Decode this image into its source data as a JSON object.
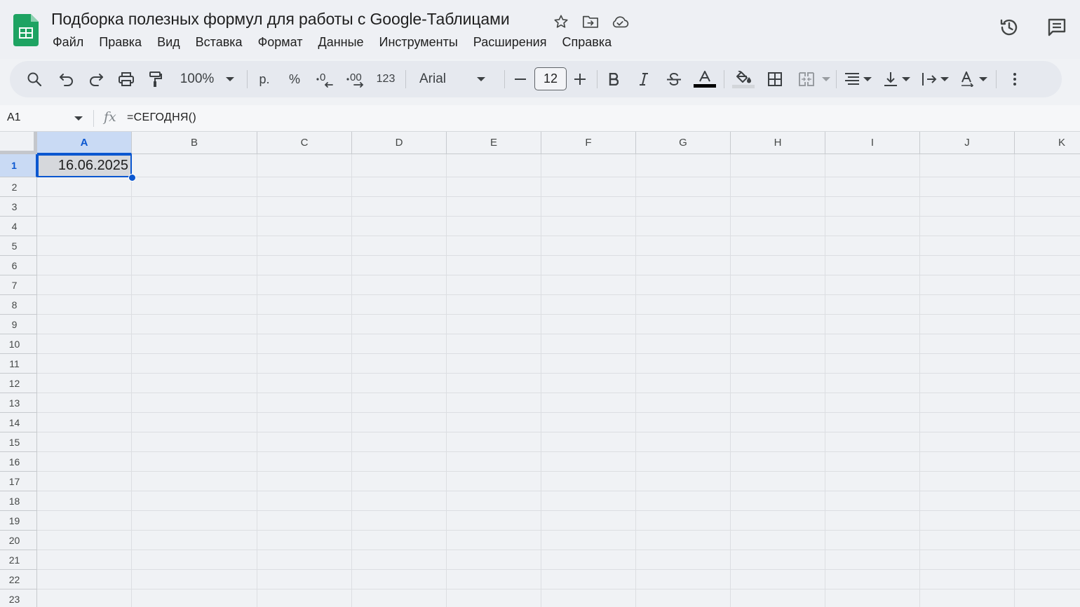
{
  "header": {
    "title": "Подборка полезных формул для работы с Google-Таблицами",
    "menu": [
      "Файл",
      "Правка",
      "Вид",
      "Вставка",
      "Формат",
      "Данные",
      "Инструменты",
      "Расширения",
      "Справка"
    ]
  },
  "toolbar": {
    "zoom": "100%",
    "currency": "р.",
    "percent": "%",
    "number_format": "123",
    "font": "Arial",
    "font_size": "12",
    "text_color": "#000000"
  },
  "formula_bar": {
    "name_box": "A1",
    "fx": "fx",
    "formula": "=СЕГОДНЯ()"
  },
  "sheet": {
    "columns": [
      "A",
      "B",
      "C",
      "D",
      "E",
      "F",
      "G",
      "H",
      "I",
      "J",
      "K"
    ],
    "rows": [
      "1",
      "2",
      "3",
      "4",
      "5",
      "6",
      "7",
      "8",
      "9",
      "10",
      "11",
      "12",
      "13",
      "14",
      "15",
      "16",
      "17",
      "18",
      "19",
      "20",
      "21",
      "22",
      "23"
    ],
    "selected_cell": "A1",
    "cells": {
      "A1": "16.06.2025"
    }
  },
  "colors": {
    "accent": "#0b57d0",
    "selection_header": "#c9daf4",
    "logo": "#1ea362"
  }
}
